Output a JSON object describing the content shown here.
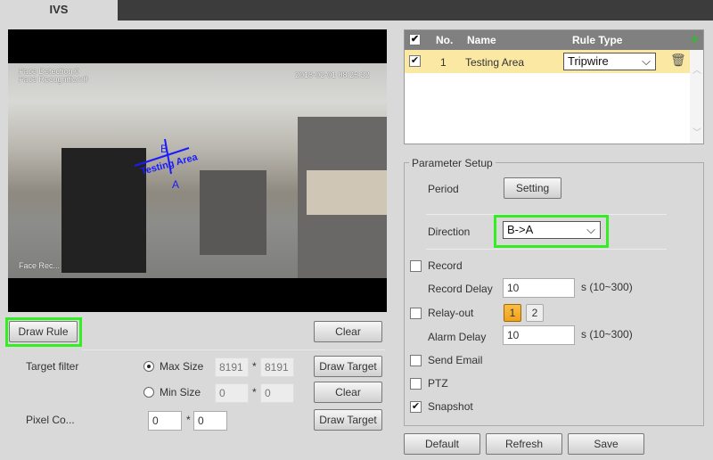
{
  "tab": {
    "title": "IVS"
  },
  "video": {
    "osd_line1": "Face Detection:0",
    "osd_line2": "Face Recognition:0",
    "timestamp": "2018-02-01 08:25:32",
    "osd_bottom": "Face Rec...",
    "rule_label": "Testing Area",
    "point_a": "A",
    "point_b": "B"
  },
  "left_controls": {
    "draw_rule": "Draw Rule",
    "clear": "Clear",
    "target_filter": "Target filter",
    "max_size": "Max Size",
    "max_w": "8191",
    "max_h": "8191",
    "min_size": "Min Size",
    "min_w": "0",
    "min_h": "0",
    "draw_target": "Draw Target",
    "clear2": "Clear",
    "pixel_co": "Pixel Co...",
    "pix_w": "0",
    "pix_h": "0",
    "draw_target2": "Draw Target",
    "times": "*"
  },
  "rules_table": {
    "headers": {
      "no": "No.",
      "name": "Name",
      "rule_type": "Rule Type"
    },
    "rows": [
      {
        "checked": true,
        "no": "1",
        "name": "Testing Area",
        "rule_type": "Tripwire"
      }
    ]
  },
  "params": {
    "legend": "Parameter Setup",
    "period": "Period",
    "setting": "Setting",
    "direction": "Direction",
    "direction_value": "B->A",
    "record": "Record",
    "record_delay": "Record Delay",
    "record_delay_value": "10",
    "range": "s (10~300)",
    "relay_out": "Relay-out",
    "relay1": "1",
    "relay2": "2",
    "alarm_delay": "Alarm Delay",
    "alarm_delay_value": "10",
    "send_email": "Send Email",
    "ptz": "PTZ",
    "snapshot": "Snapshot"
  },
  "footer": {
    "default": "Default",
    "refresh": "Refresh",
    "save": "Save"
  },
  "colors": {
    "accent_green": "#33ee22",
    "rule_blue": "#1a1aff",
    "selected_row": "#fbe9a3",
    "relay_active": "#f5a623"
  }
}
